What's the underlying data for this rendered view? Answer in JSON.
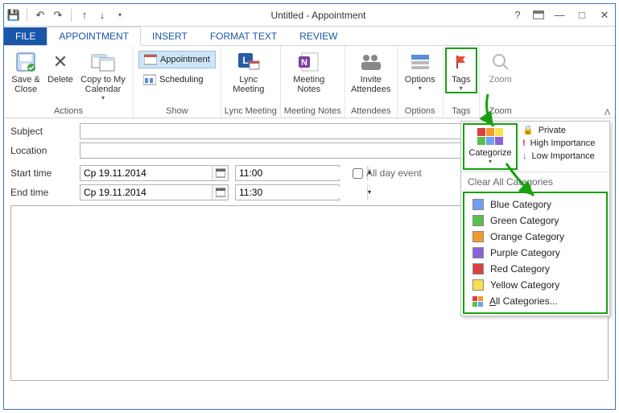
{
  "window": {
    "title": "Untitled - Appointment"
  },
  "qat": {
    "save": "💾",
    "undo": "↶",
    "redo": "↷",
    "prev": "↑",
    "next": "↓"
  },
  "tabs": {
    "file": "FILE",
    "appointment": "APPOINTMENT",
    "insert": "INSERT",
    "format_text": "FORMAT TEXT",
    "review": "REVIEW"
  },
  "ribbon": {
    "actions": {
      "label": "Actions",
      "save_close": "Save & Close",
      "delete": "Delete",
      "copy_cal": "Copy to My Calendar"
    },
    "show": {
      "label": "Show",
      "appointment": "Appointment",
      "scheduling": "Scheduling"
    },
    "lync": {
      "label": "Lync Meeting",
      "btn": "Lync Meeting"
    },
    "notes": {
      "label": "Meeting Notes",
      "btn": "Meeting Notes"
    },
    "attendees": {
      "label": "Attendees",
      "btn": "Invite Attendees"
    },
    "options": {
      "label": "Options",
      "btn": "Options"
    },
    "tags": {
      "label": "Tags",
      "btn": "Tags"
    },
    "zoom": {
      "label": "Zoom",
      "btn": "Zoom"
    }
  },
  "form": {
    "subject_label": "Subject",
    "subject_value": "",
    "location_label": "Location",
    "location_value": "",
    "start_label": "Start time",
    "end_label": "End time",
    "start_date": "Ср 19.11.2014",
    "end_date": "Ср 19.11.2014",
    "start_time": "11:00",
    "end_time": "11:30",
    "all_day": "All day event"
  },
  "tags_panel": {
    "categorize": "Categorize",
    "private": "Private",
    "high": "High Importance",
    "low": "Low Importance",
    "clear": "Clear All Categories",
    "items": [
      {
        "label": "Blue Category",
        "color": "#6f9ff3"
      },
      {
        "label": "Green Category",
        "color": "#57c14b"
      },
      {
        "label": "Orange Category",
        "color": "#f29a2e"
      },
      {
        "label": "Purple Category",
        "color": "#8a64d6"
      },
      {
        "label": "Red Category",
        "color": "#d94141"
      },
      {
        "label": "Yellow Category",
        "color": "#f6e04b"
      }
    ],
    "all": "All Categories..."
  }
}
